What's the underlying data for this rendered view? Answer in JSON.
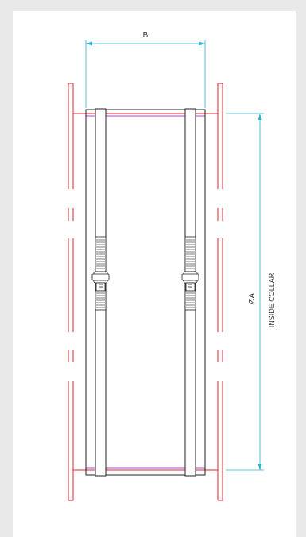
{
  "drawing": {
    "dimension_width_label": "B",
    "dimension_diameter_label": "ØA",
    "dimension_diameter_note": "INSIDE COLLAR"
  },
  "colors": {
    "background": "#e9e9e9",
    "sheet": "#ffffff",
    "outline": "#222222",
    "collar": "#e0222c",
    "dimension": "#2bb3d3",
    "magenta": "#c03cc8"
  }
}
